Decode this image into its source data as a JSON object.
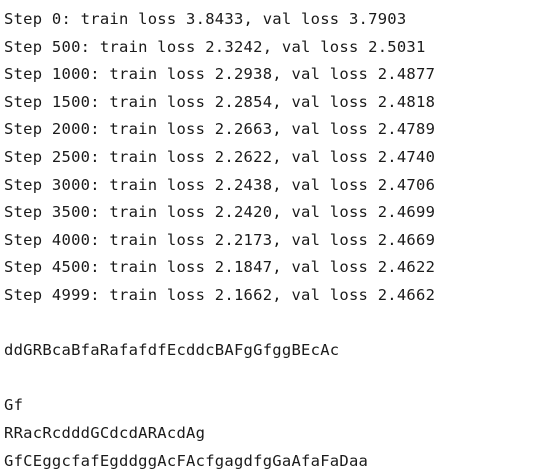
{
  "output": {
    "training_log": [
      "Step 0: train loss 3.8433, val loss 3.7903",
      "Step 500: train loss 2.3242, val loss 2.5031",
      "Step 1000: train loss 2.2938, val loss 2.4877",
      "Step 1500: train loss 2.2854, val loss 2.4818",
      "Step 2000: train loss 2.2663, val loss 2.4789",
      "Step 2500: train loss 2.2622, val loss 2.4740",
      "Step 3000: train loss 2.2438, val loss 2.4706",
      "Step 3500: train loss 2.2420, val loss 2.4699",
      "Step 4000: train loss 2.2173, val loss 2.4669",
      "Step 4500: train loss 2.1847, val loss 2.4622",
      "Step 4999: train loss 2.1662, val loss 2.4662"
    ],
    "generated_sample": [
      "ddGRBcaBfaRafafdfEcddcBAFgGfggBEcAc",
      "",
      "Gf",
      "RRacRcdddGCdcdARAcdAg",
      "GfCEggcfafEgddggAcFAcfgagdfgGaAfaFaDaa"
    ]
  }
}
